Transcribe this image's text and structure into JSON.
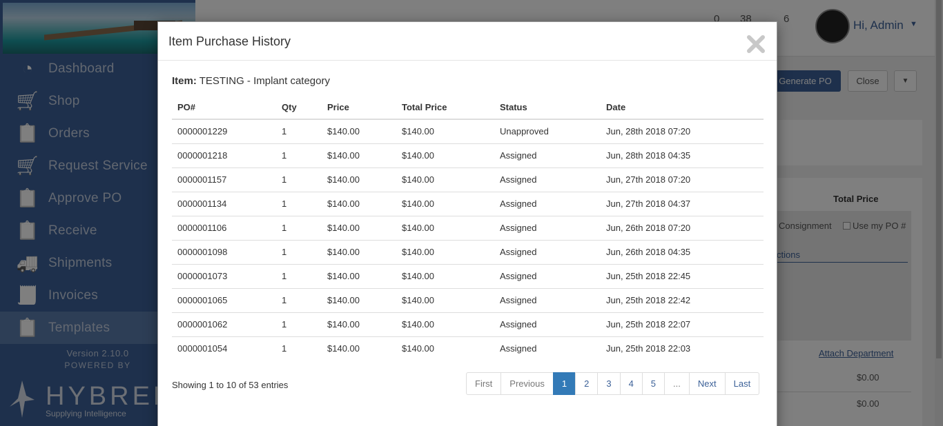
{
  "sidebar": {
    "items": [
      {
        "label": "Dashboard",
        "icon": "dashboard-gauge-icon"
      },
      {
        "label": "Shop",
        "icon": "shopping-cart-icon"
      },
      {
        "label": "Orders",
        "icon": "orders-clipboard-search-icon"
      },
      {
        "label": "Request Service",
        "icon": "request-service-cart-icon"
      },
      {
        "label": "Approve PO",
        "icon": "approve-clipboard-check-icon"
      },
      {
        "label": "Receive",
        "icon": "receive-clipboard-icon"
      },
      {
        "label": "Shipments",
        "icon": "truck-icon"
      },
      {
        "label": "Invoices",
        "icon": "invoice-receipt-icon"
      },
      {
        "label": "Templates",
        "icon": "templates-clipboard-icon"
      }
    ],
    "active_index": 8,
    "version": "Version 2.10.0",
    "powered_by": "POWERED BY",
    "logo_word": "HYBRENT",
    "logo_tagline": "Supplying Intelligence"
  },
  "header": {
    "counts": [
      "0",
      "38",
      "6"
    ],
    "greeting": "Hi, Admin"
  },
  "background": {
    "generate_po": "Generate PO",
    "close": "Close",
    "total_price_header": "Total Price",
    "consignment": "Consignment",
    "use_my_po": "Use my PO #",
    "actions": "ctions",
    "attach_department": "Attach Department",
    "value_1": "$0.00",
    "value_2": "$0.00"
  },
  "modal": {
    "title": "Item Purchase History",
    "item_label": "Item:",
    "item_value": "TESTING - Implant category",
    "columns": [
      "PO#",
      "Qty",
      "Price",
      "Total Price",
      "Status",
      "Date"
    ],
    "rows": [
      {
        "po": "0000001229",
        "qty": "1",
        "price": "$140.00",
        "total": "$140.00",
        "status": "Unapproved",
        "date": "Jun, 28th 2018 07:20"
      },
      {
        "po": "0000001218",
        "qty": "1",
        "price": "$140.00",
        "total": "$140.00",
        "status": "Assigned",
        "date": "Jun, 28th 2018 04:35"
      },
      {
        "po": "0000001157",
        "qty": "1",
        "price": "$140.00",
        "total": "$140.00",
        "status": "Assigned",
        "date": "Jun, 27th 2018 07:20"
      },
      {
        "po": "0000001134",
        "qty": "1",
        "price": "$140.00",
        "total": "$140.00",
        "status": "Assigned",
        "date": "Jun, 27th 2018 04:37"
      },
      {
        "po": "0000001106",
        "qty": "1",
        "price": "$140.00",
        "total": "$140.00",
        "status": "Assigned",
        "date": "Jun, 26th 2018 07:20"
      },
      {
        "po": "0000001098",
        "qty": "1",
        "price": "$140.00",
        "total": "$140.00",
        "status": "Assigned",
        "date": "Jun, 26th 2018 04:35"
      },
      {
        "po": "0000001073",
        "qty": "1",
        "price": "$140.00",
        "total": "$140.00",
        "status": "Assigned",
        "date": "Jun, 25th 2018 22:45"
      },
      {
        "po": "0000001065",
        "qty": "1",
        "price": "$140.00",
        "total": "$140.00",
        "status": "Assigned",
        "date": "Jun, 25th 2018 22:42"
      },
      {
        "po": "0000001062",
        "qty": "1",
        "price": "$140.00",
        "total": "$140.00",
        "status": "Assigned",
        "date": "Jun, 25th 2018 22:07"
      },
      {
        "po": "0000001054",
        "qty": "1",
        "price": "$140.00",
        "total": "$140.00",
        "status": "Assigned",
        "date": "Jun, 25th 2018 22:03"
      }
    ],
    "showing": "Showing 1 to 10 of 53 entries",
    "pagination": {
      "first": "First",
      "previous": "Previous",
      "pages": [
        "1",
        "2",
        "3",
        "4",
        "5",
        "..."
      ],
      "active_page": "1",
      "next": "Next",
      "last": "Last"
    }
  },
  "colors": {
    "sidebar": "#3c6198",
    "accent": "#337ab7"
  }
}
